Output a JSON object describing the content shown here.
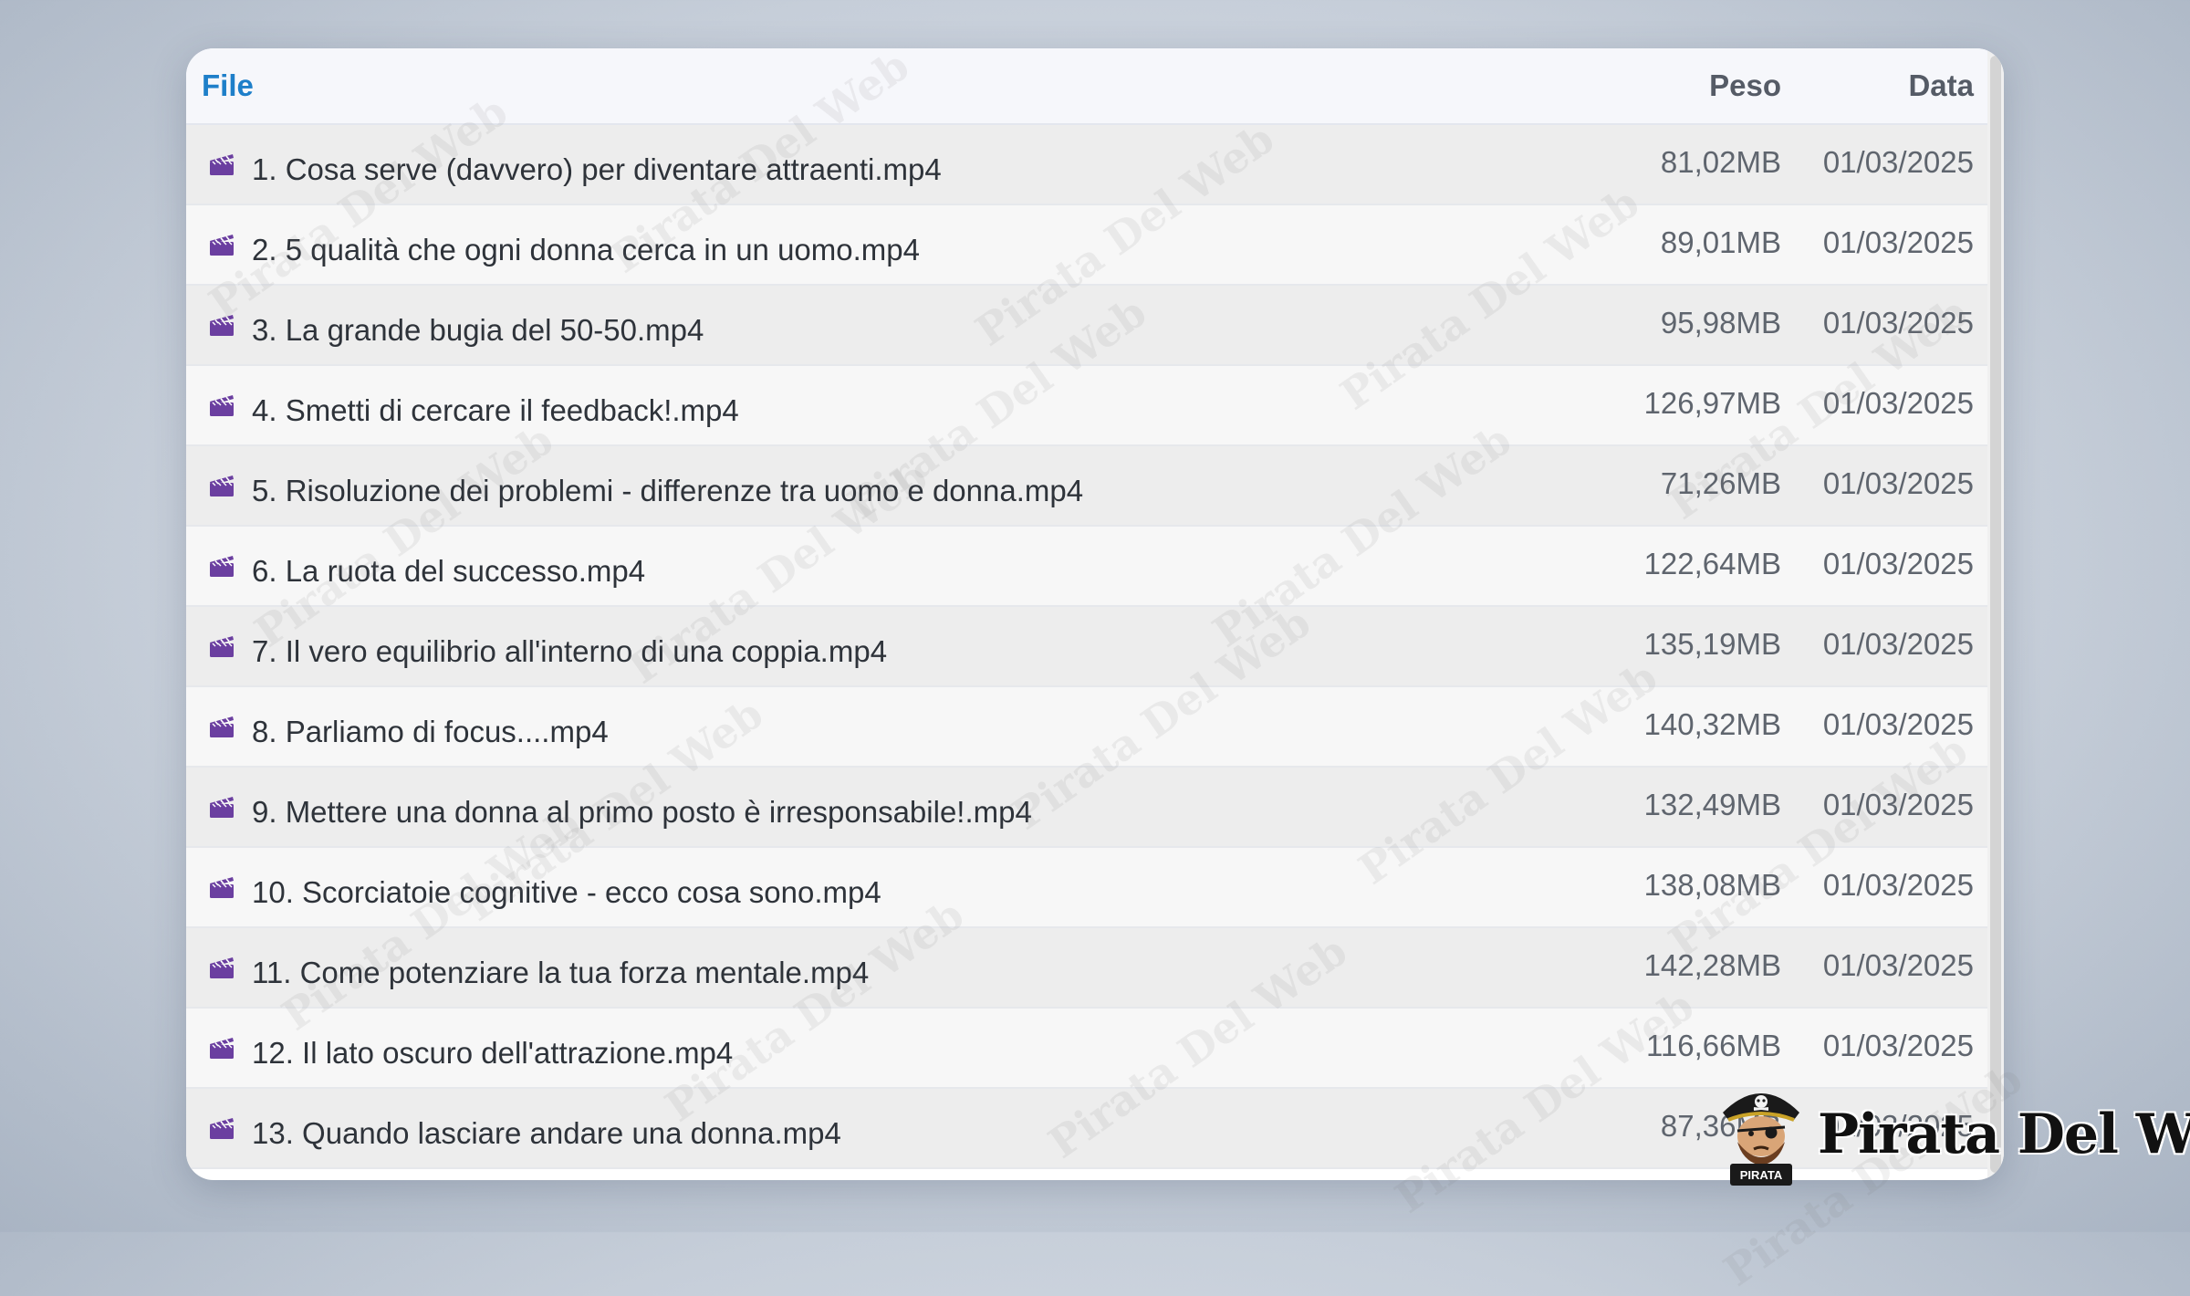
{
  "header": {
    "file_label": "File",
    "size_label": "Peso",
    "date_label": "Data"
  },
  "files": [
    {
      "name": "1. Cosa serve (davvero) per diventare attraenti.mp4",
      "size": "81,02MB",
      "date": "01/03/2025"
    },
    {
      "name": "2. 5 qualità che ogni donna cerca in un uomo.mp4",
      "size": "89,01MB",
      "date": "01/03/2025"
    },
    {
      "name": "3. La grande bugia del 50-50.mp4",
      "size": "95,98MB",
      "date": "01/03/2025"
    },
    {
      "name": "4. Smetti di cercare il feedback!.mp4",
      "size": "126,97MB",
      "date": "01/03/2025"
    },
    {
      "name": "5. Risoluzione dei problemi - differenze tra uomo e donna.mp4",
      "size": "71,26MB",
      "date": "01/03/2025"
    },
    {
      "name": "6. La ruota del successo.mp4",
      "size": "122,64MB",
      "date": "01/03/2025"
    },
    {
      "name": "7. Il vero equilibrio all'interno di una coppia.mp4",
      "size": "135,19MB",
      "date": "01/03/2025"
    },
    {
      "name": "8. Parliamo di focus....mp4",
      "size": "140,32MB",
      "date": "01/03/2025"
    },
    {
      "name": "9. Mettere una donna al primo posto è irresponsabile!.mp4",
      "size": "132,49MB",
      "date": "01/03/2025"
    },
    {
      "name": "10. Scorciatoie cognitive - ecco cosa sono.mp4",
      "size": "138,08MB",
      "date": "01/03/2025"
    },
    {
      "name": "11. Come potenziare la tua forza mentale.mp4",
      "size": "142,28MB",
      "date": "01/03/2025"
    },
    {
      "name": "12. Il lato oscuro dell'attrazione.mp4",
      "size": "116,66MB",
      "date": "01/03/2025"
    },
    {
      "name": "13. Quando lasciare andare una donna.mp4",
      "size": "87,36MB",
      "date": "01/03/2025"
    }
  ],
  "icons": {
    "file_icon": "film-clapper-icon",
    "file_icon_color": "#6b3fa0"
  },
  "colors": {
    "header_link": "#1e7fc9",
    "row_even": "#f7f7f7",
    "row_odd": "#ededed"
  },
  "watermark": {
    "text": "Pirata Del Web"
  },
  "logo": {
    "text": "Pirata Del Web",
    "badge_text": "PIRATA"
  }
}
